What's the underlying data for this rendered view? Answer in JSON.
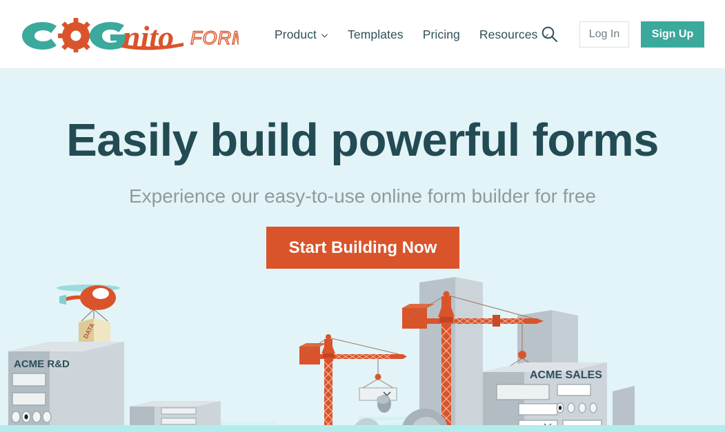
{
  "header": {
    "logo": {
      "name": "cognito-forms-logo",
      "text_c": "C",
      "text_o": "O",
      "text_g": "G",
      "text_nito": "nito",
      "text_forms": "FORMS",
      "color_teal": "#3ba99c",
      "color_orange": "#d9542b"
    },
    "nav": [
      {
        "label": "Product",
        "has_chevron": true,
        "icon": "chevron-down-icon"
      },
      {
        "label": "Templates",
        "has_chevron": false,
        "icon": ""
      },
      {
        "label": "Pricing",
        "has_chevron": false,
        "icon": ""
      },
      {
        "label": "Resources",
        "has_chevron": true,
        "icon": "chevron-down-icon"
      }
    ],
    "search": {
      "icon": "search-icon",
      "label": "Search"
    },
    "login": {
      "label": "Log In"
    },
    "signup": {
      "label": "Sign Up"
    }
  },
  "hero": {
    "title": "Easily build powerful forms",
    "subtitle": "Experience our easy-to-use online form builder for free",
    "cta_label": "Start Building Now",
    "background_color": "#e2f4f7",
    "title_color": "#234b54",
    "cta_color": "#d9542b",
    "ground_band_color": "#b2eded"
  },
  "illustration": {
    "name": "construction-site-illustration",
    "helicopter": {
      "name": "helicopter-icon",
      "body_color": "#d9542b",
      "rotor_color": "#7fd0d0",
      "cargo_label": "DATA",
      "cargo_color": "#e8d9a8"
    },
    "buildings": [
      {
        "name": "acme-rd-building",
        "label": "ACME R&D",
        "fields": 2,
        "radios": 4,
        "selected_radio": 2
      },
      {
        "name": "mid-building",
        "label": "",
        "fields": 3,
        "radios": 0,
        "selected_radio": 0
      },
      {
        "name": "acme-sales-building",
        "label": "ACME SALES",
        "fields": 4,
        "radios": 4,
        "selected_radio": 1
      }
    ],
    "cranes": [
      {
        "name": "crane-left",
        "color": "#d9542b",
        "hoisted_item": "text-field"
      },
      {
        "name": "crane-right",
        "color": "#d9542b",
        "hoisted_item": "dropdown-field"
      }
    ],
    "dropdown_caret": "chevron-down-icon",
    "building_color": "#b9c2c9",
    "building_face_color": "#cdd5db",
    "field_color": "#eef1f2"
  }
}
